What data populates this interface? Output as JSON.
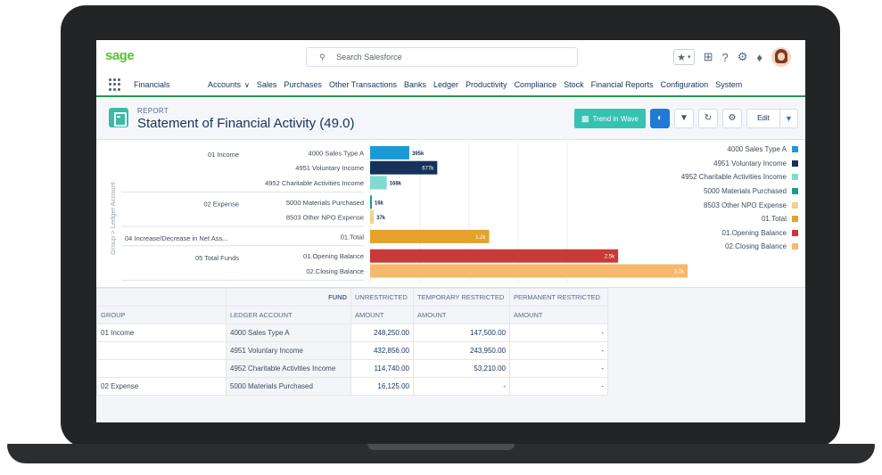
{
  "header": {
    "logo": "sage",
    "search_placeholder": "Search Salesforce",
    "icons": [
      "search-icon",
      "star-icon",
      "chevron-down-icon",
      "plus-icon",
      "help-icon",
      "gear-icon",
      "bell-icon"
    ]
  },
  "nav": {
    "app_name": "Financials",
    "items": [
      {
        "label": "Accounts",
        "has_dropdown": true
      },
      {
        "label": "Sales"
      },
      {
        "label": "Purchases"
      },
      {
        "label": "Other Transactions"
      },
      {
        "label": "Banks"
      },
      {
        "label": "Ledger"
      },
      {
        "label": "Productivity"
      },
      {
        "label": "Compliance"
      },
      {
        "label": "Stock"
      },
      {
        "label": "Financial Reports"
      },
      {
        "label": "Configuration"
      },
      {
        "label": "System"
      }
    ]
  },
  "page_header": {
    "label": "REPORT",
    "title": "Statement of Financial Activity (49.0)",
    "trend_button": "Trend in Wave",
    "edit_button": "Edit"
  },
  "colors": {
    "accent_green": "#1e9c4f",
    "brand_green": "#5bc236",
    "wave_teal": "#35c2b0",
    "primary_blue": "#1f7ad8"
  },
  "chart_data": {
    "type": "bar",
    "orientation": "horizontal",
    "y_axis_label": "Group > Ledger Account",
    "groups": [
      {
        "name": "01 Income",
        "rows": [
          {
            "label": "4000 Sales Type A",
            "value": 395,
            "display": "395k",
            "color": "#1b9ad6"
          },
          {
            "label": "4951 Voluntary Income",
            "value": 677,
            "display": "677k",
            "color": "#16325c"
          },
          {
            "label": "4952 Charitable Activities Income",
            "value": 168,
            "display": "168k",
            "color": "#7fdbd0"
          }
        ]
      },
      {
        "name": "02 Expense",
        "rows": [
          {
            "label": "5000 Materials Purchased",
            "value": 16,
            "display": "16k",
            "color": "#199b8d"
          },
          {
            "label": "8503 Other NPO Expense",
            "value": 37,
            "display": "37k",
            "color": "#f0d28b"
          }
        ]
      },
      {
        "name": "04 Increase/Decrease in Net Ass...",
        "rows": [
          {
            "label": "01.Total",
            "value": 1200,
            "display": "1.2k",
            "color": "#e4a22b"
          }
        ]
      },
      {
        "name": "05 Total Funds",
        "rows": [
          {
            "label": "01.Opening Balance",
            "value": 2500,
            "display": "2.5k",
            "color": "#c73a37"
          },
          {
            "label": "02.Closing Balance",
            "value": 3200,
            "display": "3.2k",
            "color": "#f6b86a"
          }
        ]
      }
    ],
    "legend_placement": "right",
    "legend": [
      {
        "name": "4000 Sales Type A",
        "color": "#1b9ad6"
      },
      {
        "name": "4951 Voluntary Income",
        "color": "#16325c"
      },
      {
        "name": "4952 Charitable Activities Income",
        "color": "#7fdbd0"
      },
      {
        "name": "5000 Materials Purchased",
        "color": "#199b8d"
      },
      {
        "name": "8503 Other NPO Expense",
        "color": "#f0d28b"
      },
      {
        "name": "01.Total",
        "color": "#e4a22b"
      },
      {
        "name": "01.Opening Balance",
        "color": "#c73a37"
      },
      {
        "name": "02.Closing Balance",
        "color": "#f6b86a"
      }
    ],
    "grid": true
  },
  "table": {
    "fund_label": "FUND",
    "fund_columns": [
      "UNRESTRICTED",
      "TEMPORARY RESTRICTED",
      "PERMANENT RESTRICTED"
    ],
    "group_header": "GROUP",
    "ledger_header": "LEDGER ACCOUNT",
    "amount_header": "AMOUNT",
    "rows": [
      {
        "group": "01 Income",
        "ledger": "4000 Sales Type A",
        "values": [
          "248,250.00",
          "147,500.00",
          "-"
        ]
      },
      {
        "group": "",
        "ledger": "4951 Voluntary Income",
        "values": [
          "432,856.00",
          "243,950.00",
          "-"
        ]
      },
      {
        "group": "",
        "ledger": "4952 Charitable Activities Income",
        "values": [
          "114,740.00",
          "53,210.00",
          "-"
        ]
      },
      {
        "group": "02 Expense",
        "ledger": "5000 Materials Purchased",
        "values": [
          "16,125.00",
          "-",
          "-"
        ]
      }
    ]
  }
}
